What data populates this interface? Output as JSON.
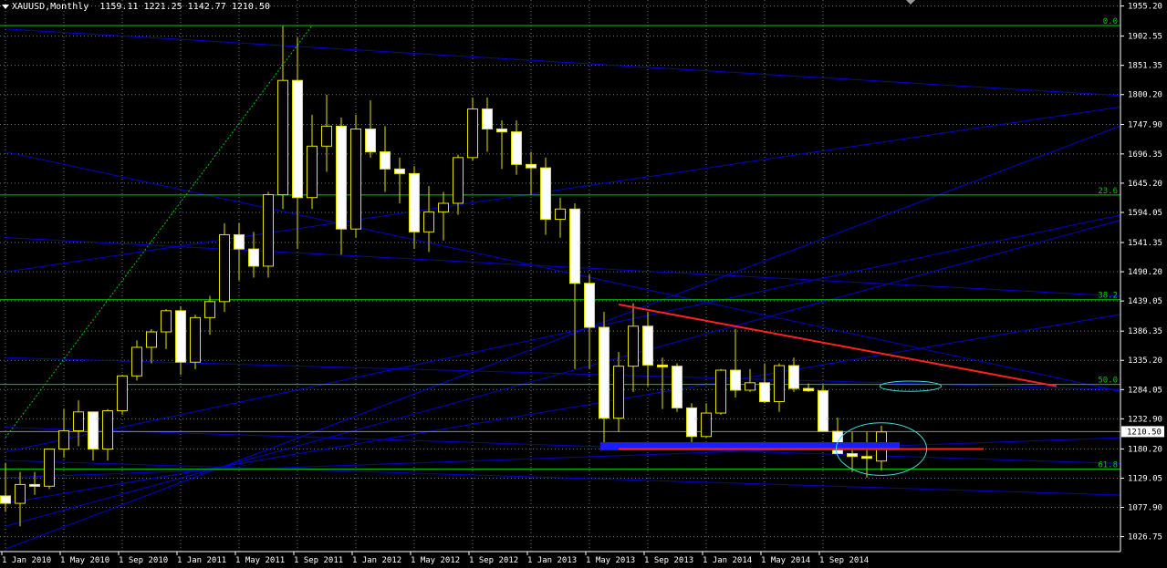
{
  "header": {
    "symbol": "XAUUSD,Monthly",
    "ohlc": "1159.11 1221.25 1142.77 1210.50"
  },
  "colors": {
    "background": "#000000",
    "grid": "#6f7a8a",
    "axis": "#ffffff",
    "bull_body": "#000000",
    "bear_body": "#ffffff",
    "wick": "#e8e000",
    "channel": "#0000cc",
    "fib": "#00cc00",
    "resistance": "#ff2020",
    "support": "#1c1cff",
    "circle": "#40d8d8",
    "price_tag": "#ffffff"
  },
  "chart_data": {
    "type": "candlestick",
    "title": "XAUUSD,Monthly",
    "ylim": [
      1000.6,
      1965.7
    ],
    "y_ticks": [
      1026.75,
      1077.9,
      1129.05,
      1180.2,
      1232.9,
      1284.05,
      1335.2,
      1386.35,
      1439.05,
      1490.2,
      1541.35,
      1594.05,
      1645.2,
      1696.35,
      1747.9,
      1800.2,
      1851.35,
      1902.55,
      1955.2
    ],
    "y_tick_labels": [
      "1026.75",
      "1077.90",
      "1129.05",
      "1180.20",
      "1232.90",
      "1284.05",
      "1335.20",
      "1386.35",
      "1439.05",
      "1490.20",
      "1541.35",
      "1594.05",
      "1645.20",
      "1696.35",
      "1747.90",
      "1800.20",
      "1851.35",
      "1902.55",
      "1955.20"
    ],
    "x_labels": [
      {
        "i": 0,
        "label": "1 Jan 2010"
      },
      {
        "i": 4,
        "label": "1 May 2010"
      },
      {
        "i": 8,
        "label": "1 Sep 2010"
      },
      {
        "i": 12,
        "label": "1 Jan 2011"
      },
      {
        "i": 16,
        "label": "1 May 2011"
      },
      {
        "i": 20,
        "label": "1 Sep 2011"
      },
      {
        "i": 24,
        "label": "1 Jan 2012"
      },
      {
        "i": 28,
        "label": "1 May 2012"
      },
      {
        "i": 32,
        "label": "1 Sep 2012"
      },
      {
        "i": 36,
        "label": "1 Jan 2013"
      },
      {
        "i": 40,
        "label": "1 May 2013"
      },
      {
        "i": 44,
        "label": "1 Sep 2013"
      },
      {
        "i": 48,
        "label": "1 Jan 2014"
      },
      {
        "i": 52,
        "label": "1 May 2014"
      },
      {
        "i": 56,
        "label": "1 Sep 2014"
      }
    ],
    "candles": [
      {
        "o": 1098,
        "h": 1156,
        "l": 1070,
        "c": 1085
      },
      {
        "o": 1085,
        "h": 1140,
        "l": 1045,
        "c": 1118
      },
      {
        "o": 1118,
        "h": 1140,
        "l": 1100,
        "c": 1115
      },
      {
        "o": 1115,
        "h": 1175,
        "l": 1110,
        "c": 1180
      },
      {
        "o": 1180,
        "h": 1250,
        "l": 1165,
        "c": 1212
      },
      {
        "o": 1212,
        "h": 1265,
        "l": 1185,
        "c": 1245
      },
      {
        "o": 1245,
        "h": 1240,
        "l": 1160,
        "c": 1180
      },
      {
        "o": 1180,
        "h": 1250,
        "l": 1160,
        "c": 1247
      },
      {
        "o": 1247,
        "h": 1310,
        "l": 1240,
        "c": 1308
      },
      {
        "o": 1308,
        "h": 1370,
        "l": 1300,
        "c": 1358
      },
      {
        "o": 1358,
        "h": 1390,
        "l": 1330,
        "c": 1385
      },
      {
        "o": 1385,
        "h": 1425,
        "l": 1355,
        "c": 1422
      },
      {
        "o": 1422,
        "h": 1430,
        "l": 1310,
        "c": 1332
      },
      {
        "o": 1332,
        "h": 1415,
        "l": 1320,
        "c": 1410
      },
      {
        "o": 1410,
        "h": 1448,
        "l": 1380,
        "c": 1438
      },
      {
        "o": 1438,
        "h": 1575,
        "l": 1420,
        "c": 1555
      },
      {
        "o": 1555,
        "h": 1575,
        "l": 1475,
        "c": 1530
      },
      {
        "o": 1530,
        "h": 1560,
        "l": 1480,
        "c": 1500
      },
      {
        "o": 1500,
        "h": 1630,
        "l": 1480,
        "c": 1625
      },
      {
        "o": 1625,
        "h": 1920,
        "l": 1600,
        "c": 1825
      },
      {
        "o": 1825,
        "h": 1900,
        "l": 1530,
        "c": 1620
      },
      {
        "o": 1620,
        "h": 1765,
        "l": 1600,
        "c": 1710
      },
      {
        "o": 1710,
        "h": 1800,
        "l": 1665,
        "c": 1745
      },
      {
        "o": 1745,
        "h": 1760,
        "l": 1520,
        "c": 1565
      },
      {
        "o": 1565,
        "h": 1765,
        "l": 1550,
        "c": 1740
      },
      {
        "o": 1740,
        "h": 1790,
        "l": 1690,
        "c": 1700
      },
      {
        "o": 1700,
        "h": 1745,
        "l": 1630,
        "c": 1670
      },
      {
        "o": 1670,
        "h": 1690,
        "l": 1610,
        "c": 1662
      },
      {
        "o": 1662,
        "h": 1675,
        "l": 1530,
        "c": 1560
      },
      {
        "o": 1560,
        "h": 1640,
        "l": 1525,
        "c": 1595
      },
      {
        "o": 1595,
        "h": 1630,
        "l": 1545,
        "c": 1610
      },
      {
        "o": 1610,
        "h": 1695,
        "l": 1590,
        "c": 1690
      },
      {
        "o": 1690,
        "h": 1795,
        "l": 1685,
        "c": 1775
      },
      {
        "o": 1775,
        "h": 1795,
        "l": 1700,
        "c": 1740
      },
      {
        "o": 1740,
        "h": 1755,
        "l": 1670,
        "c": 1735
      },
      {
        "o": 1735,
        "h": 1755,
        "l": 1660,
        "c": 1678
      },
      {
        "o": 1678,
        "h": 1700,
        "l": 1625,
        "c": 1672
      },
      {
        "o": 1672,
        "h": 1690,
        "l": 1555,
        "c": 1582
      },
      {
        "o": 1582,
        "h": 1620,
        "l": 1550,
        "c": 1600
      },
      {
        "o": 1600,
        "h": 1610,
        "l": 1320,
        "c": 1470
      },
      {
        "o": 1470,
        "h": 1485,
        "l": 1320,
        "c": 1393
      },
      {
        "o": 1393,
        "h": 1420,
        "l": 1180,
        "c": 1234
      },
      {
        "o": 1234,
        "h": 1350,
        "l": 1210,
        "c": 1325
      },
      {
        "o": 1325,
        "h": 1435,
        "l": 1280,
        "c": 1395
      },
      {
        "o": 1395,
        "h": 1420,
        "l": 1290,
        "c": 1327
      },
      {
        "o": 1327,
        "h": 1340,
        "l": 1250,
        "c": 1325
      },
      {
        "o": 1325,
        "h": 1330,
        "l": 1245,
        "c": 1252
      },
      {
        "o": 1252,
        "h": 1260,
        "l": 1180,
        "c": 1202
      },
      {
        "o": 1202,
        "h": 1260,
        "l": 1200,
        "c": 1243
      },
      {
        "o": 1243,
        "h": 1320,
        "l": 1240,
        "c": 1318
      },
      {
        "o": 1318,
        "h": 1390,
        "l": 1270,
        "c": 1283
      },
      {
        "o": 1283,
        "h": 1320,
        "l": 1280,
        "c": 1296
      },
      {
        "o": 1296,
        "h": 1330,
        "l": 1260,
        "c": 1263
      },
      {
        "o": 1263,
        "h": 1330,
        "l": 1245,
        "c": 1326
      },
      {
        "o": 1326,
        "h": 1340,
        "l": 1280,
        "c": 1286
      },
      {
        "o": 1286,
        "h": 1295,
        "l": 1280,
        "c": 1282
      },
      {
        "o": 1282,
        "h": 1292,
        "l": 1210,
        "c": 1211
      },
      {
        "o": 1211,
        "h": 1235,
        "l": 1175,
        "c": 1172
      },
      {
        "o": 1172,
        "h": 1210,
        "l": 1140,
        "c": 1167
      },
      {
        "o": 1167,
        "h": 1210,
        "l": 1130,
        "c": 1166
      },
      {
        "o": 1159,
        "h": 1221,
        "l": 1142,
        "c": 1210
      }
    ],
    "fib_levels": [
      {
        "price": 1921.0,
        "label": "0.0"
      },
      {
        "price": 1624.6,
        "label": "23.6"
      },
      {
        "price": 1441.3,
        "label": "38.2"
      },
      {
        "price": 1293.1,
        "label": "50.0"
      },
      {
        "price": 1145.1,
        "label": "61.8"
      }
    ],
    "last_price": {
      "price": 1210.5,
      "label": "1210.50"
    },
    "current_price_line": 1210.5,
    "channel_lines": [
      {
        "i1": 0,
        "p1": 1005,
        "i2": 82,
        "p2": 1800
      },
      {
        "i1": 0,
        "p1": 1045,
        "i2": 82,
        "p2": 1620
      },
      {
        "i1": 0,
        "p1": 1085,
        "i2": 82,
        "p2": 1440
      },
      {
        "i1": 0,
        "p1": 1130,
        "i2": 82,
        "p2": 1205
      },
      {
        "i1": 0,
        "p1": 1175,
        "i2": 82,
        "p2": 1620
      },
      {
        "i1": 0,
        "p1": 1340,
        "i2": 82,
        "p2": 1280
      },
      {
        "i1": 0,
        "p1": 1218,
        "i2": 82,
        "p2": 1150
      },
      {
        "i1": 0,
        "p1": 1490,
        "i2": 82,
        "p2": 1800
      },
      {
        "i1": 0,
        "p1": 1550,
        "i2": 82,
        "p2": 1440
      },
      {
        "i1": 0,
        "p1": 1700,
        "i2": 82,
        "p2": 1250
      },
      {
        "i1": 0,
        "p1": 1915,
        "i2": 82,
        "p2": 1790
      },
      {
        "i1": 0,
        "p1": 1160,
        "i2": 82,
        "p2": 1095
      }
    ],
    "fib_anchor_line": {
      "i1": 0,
      "p1": 1200,
      "i2": 21,
      "p2": 1921
    },
    "resistance_line": {
      "i1": 42,
      "p1": 1433,
      "i2": 72,
      "p2": 1290
    },
    "support_line": {
      "i1": 42,
      "p1": 1180,
      "i2": 67,
      "p2": 1180
    },
    "support_zone": {
      "i1": 41,
      "i2": 61,
      "top": 1192,
      "bottom": 1178
    },
    "ellipses": [
      {
        "i": 62,
        "price": 1290,
        "ri": 2.1,
        "rp": 9
      },
      {
        "i": 60,
        "price": 1180,
        "ri": 3.1,
        "rp": 46
      }
    ],
    "top_marker": {
      "i": 62
    }
  }
}
